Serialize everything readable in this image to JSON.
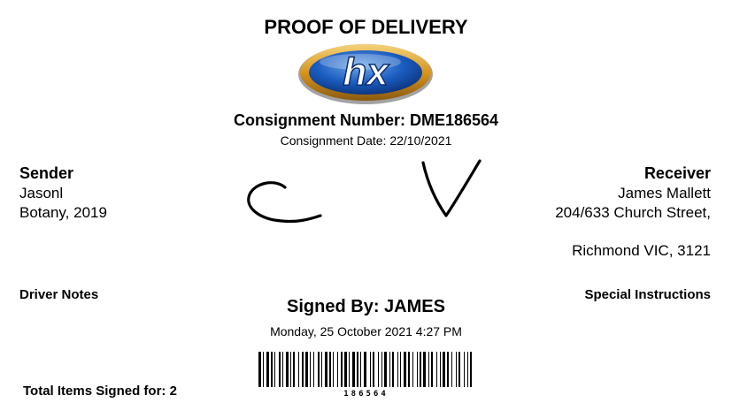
{
  "document": {
    "title": "PROOF OF DELIVERY",
    "logo_text": "hx",
    "consignment_number": "Consignment Number: DME186564",
    "consignment_date": "Consignment Date: 22/10/2021"
  },
  "sender": {
    "heading": "Sender",
    "name": "Jasonl",
    "location": "Botany, 2019"
  },
  "receiver": {
    "heading": "Receiver",
    "name": "James Mallett",
    "address_line1": "204/633 Church Street,",
    "address_line2": "Richmond VIC, 3121"
  },
  "notes": {
    "driver_notes_label": "Driver Notes",
    "special_instructions_label": "Special Instructions"
  },
  "signature": {
    "signed_by": "Signed By: JAMES",
    "signed_datetime": "Monday, 25 October 2021 4:27 PM"
  },
  "barcode": {
    "value": "186564"
  },
  "summary": {
    "total_items": "Total Items Signed for: 2"
  },
  "colors": {
    "logo_blue": "#0c4aa6",
    "logo_gold": "#e0a020"
  }
}
